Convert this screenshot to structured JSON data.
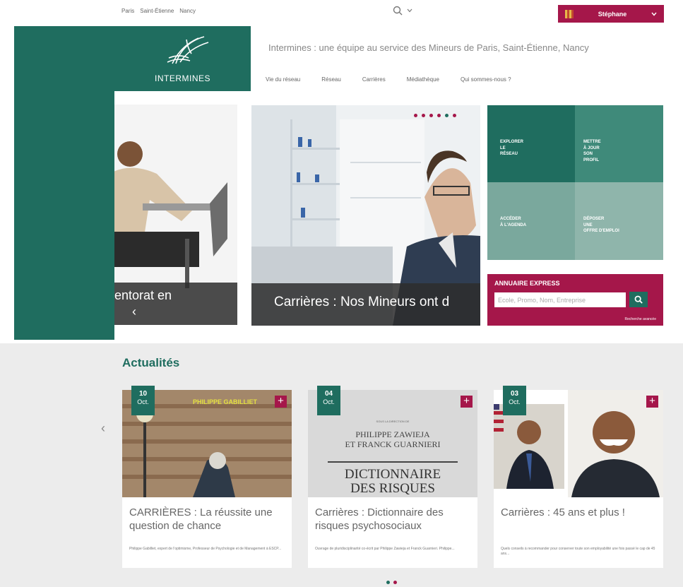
{
  "topbar": {
    "cities": [
      "Paris",
      "Saint-Étienne",
      "Nancy"
    ],
    "user_name": "Stéphane"
  },
  "logo": {
    "text": "INTERMINES"
  },
  "header": {
    "tagline": "Intermines : une équipe au service des Mineurs de Paris, Saint-Étienne, Nancy",
    "nav": [
      "Vie du réseau",
      "Réseau",
      "Carrières",
      "Médiathèque",
      "Qui sommes-nous ?"
    ]
  },
  "hero": {
    "left_caption": "entorat en",
    "main_caption": "Carrières : Nos Mineurs ont d",
    "dot_count": 6,
    "active_dot": 4
  },
  "tiles": [
    {
      "label": "Explorer\nle\nréseau"
    },
    {
      "label": "Mettre\nà jour\nson\nprofil"
    },
    {
      "label": "Accéder\nà l'agenda"
    },
    {
      "label": "Déposer\nune\noffre d'emploi"
    }
  ],
  "annuaire": {
    "title": "ANNUAIRE EXPRESS",
    "placeholder": "Ecole, Promo, Nom, Entreprise",
    "advanced_link": "Recherche avancée"
  },
  "news": {
    "title": "Actualités",
    "cards": [
      {
        "day": "10",
        "month": "Oct.",
        "image_text": "PHILIPPE GABILLIET",
        "title": "CARRIÈRES : La réussite une question de chance",
        "excerpt": "Philippe Gabilliet, expert de l'optimisme, Professeur de Psychologie et de Management à ESCP..."
      },
      {
        "day": "04",
        "month": "Oct.",
        "image_small": "SOUS LA DIRECTION DE",
        "image_authors": "PHILIPPE ZAWIEJA\nET FRANCK GUARNIERI",
        "image_title": "DICTIONNAIRE\nDES RISQUES",
        "title": "Carrières : Dictionnaire des risques psychosociaux",
        "excerpt": "Ouvrage de pluridisciplinarité co-écrit par Philippe Zawieja et Franck Guarnieri. Philippe..."
      },
      {
        "day": "03",
        "month": "Oct.",
        "title": "Carrières : 45 ans et plus !",
        "excerpt": "Quels conseils à recommander pour conserver toute son employabilité une fois passé le cap de 45 ans..."
      }
    ],
    "pager_colors": [
      "#1f6d5f",
      "#a5174a"
    ]
  },
  "colors": {
    "green": "#1f6d5f",
    "crimson": "#a5174a"
  },
  "icons": {
    "search": "search-icon",
    "chevron": "chevron-down-icon",
    "plus": "plus-icon",
    "prev": "chevron-left-icon"
  }
}
